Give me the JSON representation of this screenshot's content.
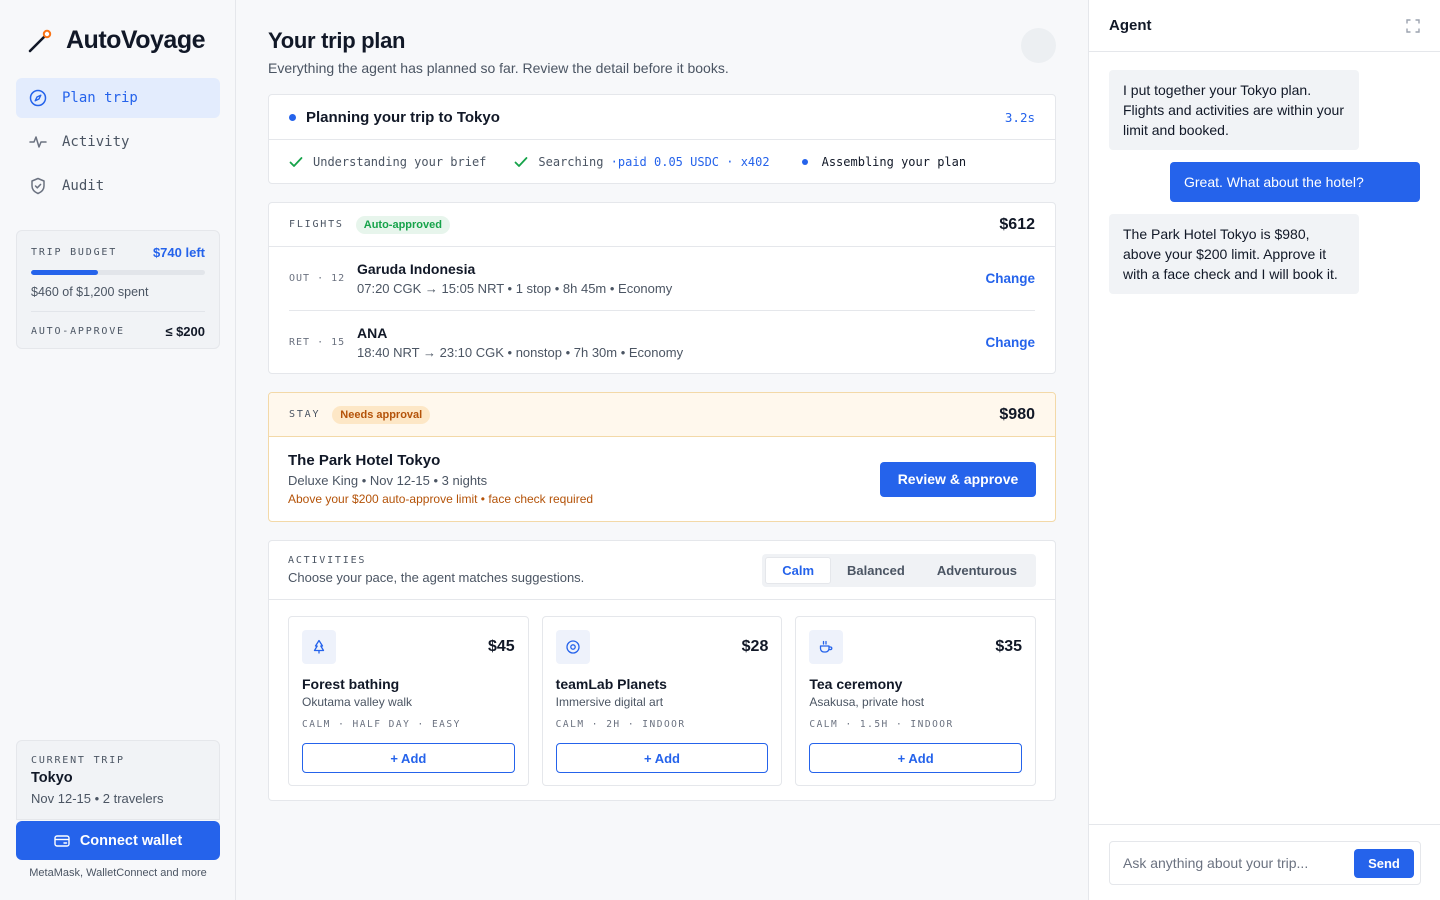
{
  "app": {
    "name": "AutoVoyage"
  },
  "sidebar": {
    "nav": [
      {
        "label": "Plan trip",
        "icon": "compass-icon",
        "active": true
      },
      {
        "label": "Activity",
        "icon": "pulse-icon",
        "active": false
      },
      {
        "label": "Audit",
        "icon": "shield-check-icon",
        "active": false
      }
    ],
    "budget": {
      "label": "TRIP BUDGET",
      "left": "$740 left",
      "spent_text": "$460 of $1,200 spent",
      "progress_fraction": 0.383,
      "auto_approve_label": "AUTO-APPROVE",
      "auto_approve_value": "≤ $200"
    },
    "current_trip": {
      "label": "CURRENT TRIP",
      "city": "Tokyo",
      "dates": "Nov 12-15 • 2 travelers"
    },
    "connect_wallet": "Connect wallet",
    "wallet_note": "MetaMask, WalletConnect and more"
  },
  "main": {
    "title": "Your trip plan",
    "subtitle": "Everything the agent has planned so far. Review the detail before it books.",
    "status": {
      "title": "Planning your trip to Tokyo",
      "timer": "3.2s",
      "steps": [
        {
          "label": "Understanding your brief",
          "state": "done"
        },
        {
          "label": "Searching",
          "extra": "·paid 0.05 USDC · x402",
          "state": "done"
        },
        {
          "label": "Assembling your plan",
          "state": "current"
        }
      ]
    },
    "flights": {
      "label": "FLIGHTS",
      "badge": "Auto-approved",
      "price": "$612",
      "rows": [
        {
          "leg": "OUT · 12",
          "airline": "Garuda Indonesia",
          "route": "07:20 CGK → 15:05 NRT • 1 stop • 8h 45m • Economy",
          "action": "Change"
        },
        {
          "leg": "RET · 15",
          "airline": "ANA",
          "route": "18:40 NRT → 23:10 CGK • nonstop • 7h 30m • Economy",
          "action": "Change"
        }
      ]
    },
    "stay": {
      "label": "STAY",
      "badge": "Needs approval",
      "price": "$980",
      "hotel": "The Park Hotel Tokyo",
      "detail": "Deluxe King • Nov 12-15 • 3 nights",
      "warning": "Above your $200 auto-approve limit • face check required",
      "action": "Review & approve"
    },
    "activities": {
      "label": "ACTIVITIES",
      "subtitle": "Choose your pace, the agent matches suggestions.",
      "pace_options": [
        "Calm",
        "Balanced",
        "Adventurous"
      ],
      "pace_selected": "Calm",
      "items": [
        {
          "icon": "tree-icon",
          "price": "$45",
          "name": "Forest bathing",
          "sub": "Okutama valley walk",
          "tags": "CALM · HALF DAY · EASY",
          "action": "+ Add"
        },
        {
          "icon": "target-icon",
          "price": "$28",
          "name": "teamLab Planets",
          "sub": "Immersive digital art",
          "tags": "CALM · 2H · INDOOR",
          "action": "+ Add"
        },
        {
          "icon": "tea-cup-icon",
          "price": "$35",
          "name": "Tea ceremony",
          "sub": "Asakusa, private host",
          "tags": "CALM · 1.5H · INDOOR",
          "action": "+ Add"
        }
      ]
    }
  },
  "agent": {
    "title": "Agent",
    "messages": [
      {
        "from": "agent",
        "text": "I put together your Tokyo plan. Flights and activities are within your limit and booked."
      },
      {
        "from": "user",
        "text": "Great. What about the hotel?"
      },
      {
        "from": "agent",
        "text": "The Park Hotel Tokyo is $980, above your $200 limit. Approve it with a face check and I will book it."
      }
    ],
    "input_placeholder": "Ask anything about your trip...",
    "send_label": "Send"
  },
  "colors": {
    "accent": "#2563eb",
    "success": "#16a34a",
    "warning": "#b45309"
  }
}
